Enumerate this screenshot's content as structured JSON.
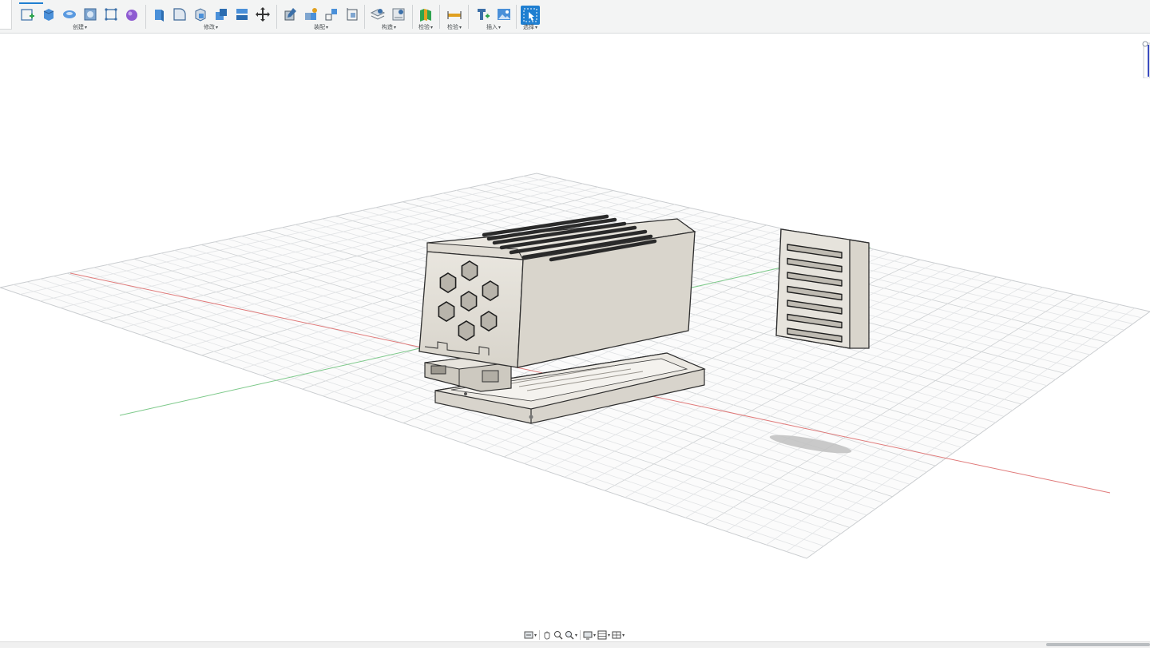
{
  "toolbar": {
    "groups": [
      {
        "id": "create",
        "label": "创建",
        "caret": "▾"
      },
      {
        "id": "modify",
        "label": "修改",
        "caret": "▾"
      },
      {
        "id": "assemble",
        "label": "装配",
        "caret": "▾"
      },
      {
        "id": "construct",
        "label": "构造",
        "caret": "▾"
      },
      {
        "id": "inspect",
        "label": "检验",
        "caret": "▾"
      },
      {
        "id": "measure",
        "label": "检验",
        "caret": "▾"
      },
      {
        "id": "insert",
        "label": "插入",
        "caret": "▾"
      },
      {
        "id": "select",
        "label": "选择",
        "caret": "▾"
      }
    ]
  },
  "colors": {
    "accent": "#1f7fd1",
    "grid_line": "#e1e3e5",
    "grid_major": "#cfd2d4",
    "x_axis": "#e07a7a",
    "y_axis": "#7dc98a",
    "body_fill": "#e6e3dc",
    "body_shade": "#d4d0c7",
    "body_edge": "#3a3a3a"
  },
  "navbar": {
    "items": [
      "orbit-icon",
      "pan-icon",
      "zoom-icon",
      "zoom-window-icon",
      "display-mode-icon",
      "grid-settings-icon",
      "viewport-icon"
    ]
  }
}
